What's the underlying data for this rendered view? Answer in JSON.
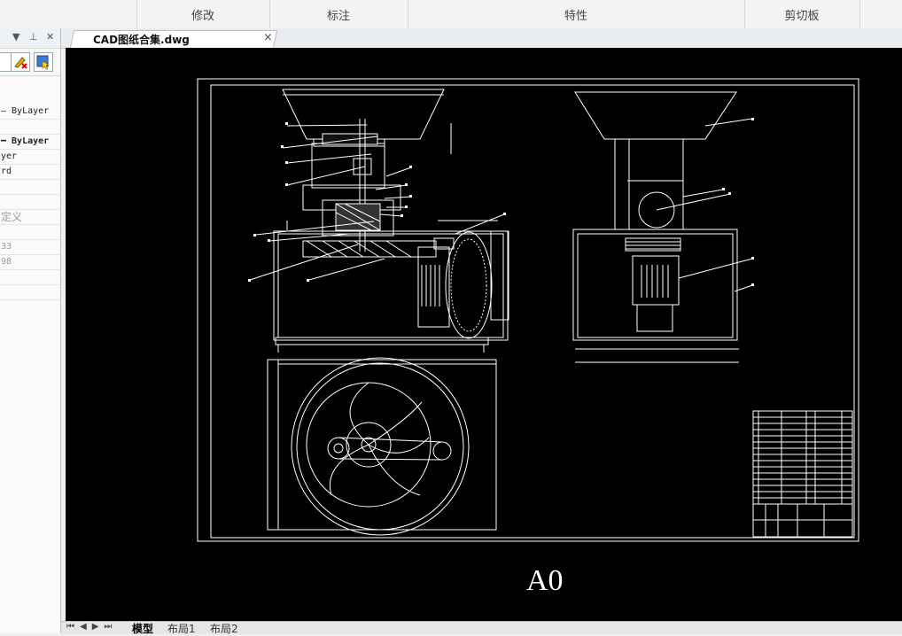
{
  "ribbon": {
    "groups": [
      "修改",
      "标注",
      "特性",
      "剪切板"
    ]
  },
  "left_panel": {
    "controls": [
      "▼",
      "⊥",
      "✕"
    ],
    "properties": [
      "— ByLayer",
      "",
      "━ ByLayer",
      "yer",
      "rd",
      "",
      "",
      "定义",
      "",
      "33",
      "98",
      "",
      ""
    ]
  },
  "document_tab": {
    "title": "CAD图纸合集.dwg",
    "close": "×"
  },
  "drawing": {
    "label": "A0"
  },
  "bottom_tabs": {
    "nav": "⏮◀▶⏭",
    "model": "模型",
    "layout1": "布局1",
    "layout2": "布局2"
  },
  "colors": {
    "canvas_bg": "#000000",
    "line": "#ffffff"
  }
}
